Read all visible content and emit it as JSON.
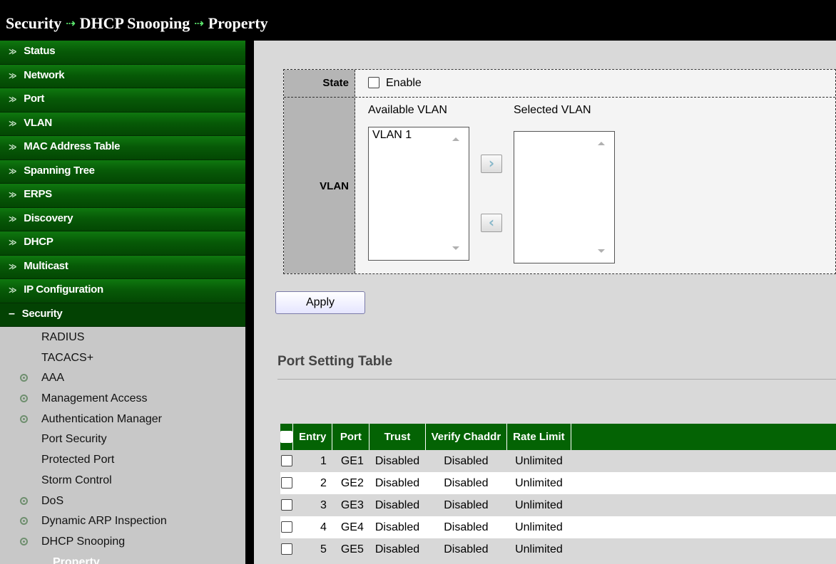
{
  "breadcrumb": [
    "Security",
    "DHCP Snooping",
    "Property"
  ],
  "sidebar": {
    "items": [
      {
        "label": "Status"
      },
      {
        "label": "Network"
      },
      {
        "label": "Port"
      },
      {
        "label": "VLAN"
      },
      {
        "label": "MAC Address Table"
      },
      {
        "label": "Spanning Tree"
      },
      {
        "label": "ERPS"
      },
      {
        "label": "Discovery"
      },
      {
        "label": "DHCP"
      },
      {
        "label": "Multicast"
      },
      {
        "label": "IP Configuration"
      }
    ],
    "expanded": {
      "label": "Security",
      "children": [
        {
          "label": "RADIUS",
          "bullet": false
        },
        {
          "label": "TACACS+",
          "bullet": false
        },
        {
          "label": "AAA",
          "bullet": true
        },
        {
          "label": "Management Access",
          "bullet": true
        },
        {
          "label": "Authentication Manager",
          "bullet": true
        },
        {
          "label": "Port Security",
          "bullet": false
        },
        {
          "label": "Protected Port",
          "bullet": false
        },
        {
          "label": "Storm Control",
          "bullet": false
        },
        {
          "label": "DoS",
          "bullet": true
        },
        {
          "label": "Dynamic ARP Inspection",
          "bullet": true
        },
        {
          "label": "DHCP Snooping",
          "bullet": true
        },
        {
          "label": "Property",
          "bullet": false,
          "active": true
        }
      ]
    }
  },
  "form": {
    "state_label": "State",
    "enable_label": "Enable",
    "enable_checked": false,
    "vlan_label": "VLAN",
    "available_vlan_label": "Available VLAN",
    "selected_vlan_label": "Selected VLAN",
    "available_vlans": [
      "VLAN 1"
    ],
    "selected_vlans": [],
    "add_glyph": "›",
    "remove_glyph": "‹",
    "apply_label": "Apply"
  },
  "port_table": {
    "title": "Port Setting Table",
    "columns": [
      "Entry",
      "Port",
      "Trust",
      "Verify Chaddr",
      "Rate Limit"
    ],
    "rows": [
      {
        "entry": "1",
        "port": "GE1",
        "trust": "Disabled",
        "verify": "Disabled",
        "rate": "Unlimited"
      },
      {
        "entry": "2",
        "port": "GE2",
        "trust": "Disabled",
        "verify": "Disabled",
        "rate": "Unlimited"
      },
      {
        "entry": "3",
        "port": "GE3",
        "trust": "Disabled",
        "verify": "Disabled",
        "rate": "Unlimited"
      },
      {
        "entry": "4",
        "port": "GE4",
        "trust": "Disabled",
        "verify": "Disabled",
        "rate": "Unlimited"
      },
      {
        "entry": "5",
        "port": "GE5",
        "trust": "Disabled",
        "verify": "Disabled",
        "rate": "Unlimited"
      }
    ]
  },
  "colors": {
    "nav_green": "#075a07",
    "header_green": "#046304",
    "title_arrow": "#5be36c"
  }
}
